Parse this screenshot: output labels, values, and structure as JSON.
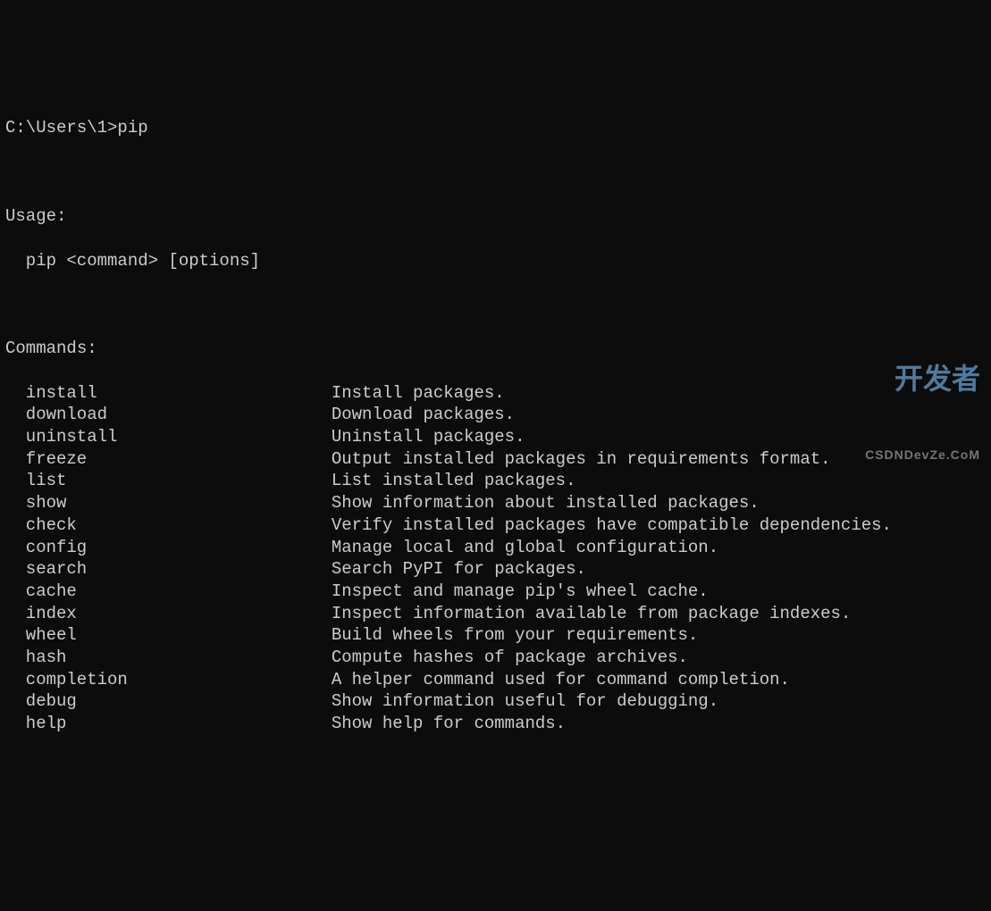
{
  "prompt": {
    "path": "C:\\Users\\1>",
    "command": "pip"
  },
  "usage": {
    "header": "Usage:",
    "text": "pip <command> [options]"
  },
  "commands": {
    "header": "Commands:",
    "items": [
      {
        "name": "install",
        "desc": "Install packages."
      },
      {
        "name": "download",
        "desc": "Download packages."
      },
      {
        "name": "uninstall",
        "desc": "Uninstall packages."
      },
      {
        "name": "freeze",
        "desc": "Output installed packages in requirements format."
      },
      {
        "name": "list",
        "desc": "List installed packages."
      },
      {
        "name": "show",
        "desc": "Show information about installed packages."
      },
      {
        "name": "check",
        "desc": "Verify installed packages have compatible dependencies."
      },
      {
        "name": "config",
        "desc": "Manage local and global configuration."
      },
      {
        "name": "search",
        "desc": "Search PyPI for packages."
      },
      {
        "name": "cache",
        "desc": "Inspect and manage pip's wheel cache."
      },
      {
        "name": "index",
        "desc": "Inspect information available from package indexes."
      },
      {
        "name": "wheel",
        "desc": "Build wheels from your requirements."
      },
      {
        "name": "hash",
        "desc": "Compute hashes of package archives."
      },
      {
        "name": "completion",
        "desc": "A helper command used for command completion."
      },
      {
        "name": "debug",
        "desc": "Show information useful for debugging."
      },
      {
        "name": "help",
        "desc": "Show help for commands."
      }
    ]
  },
  "watermark": {
    "main": "开发者",
    "sub": "CSDNDevZe.CoM"
  }
}
